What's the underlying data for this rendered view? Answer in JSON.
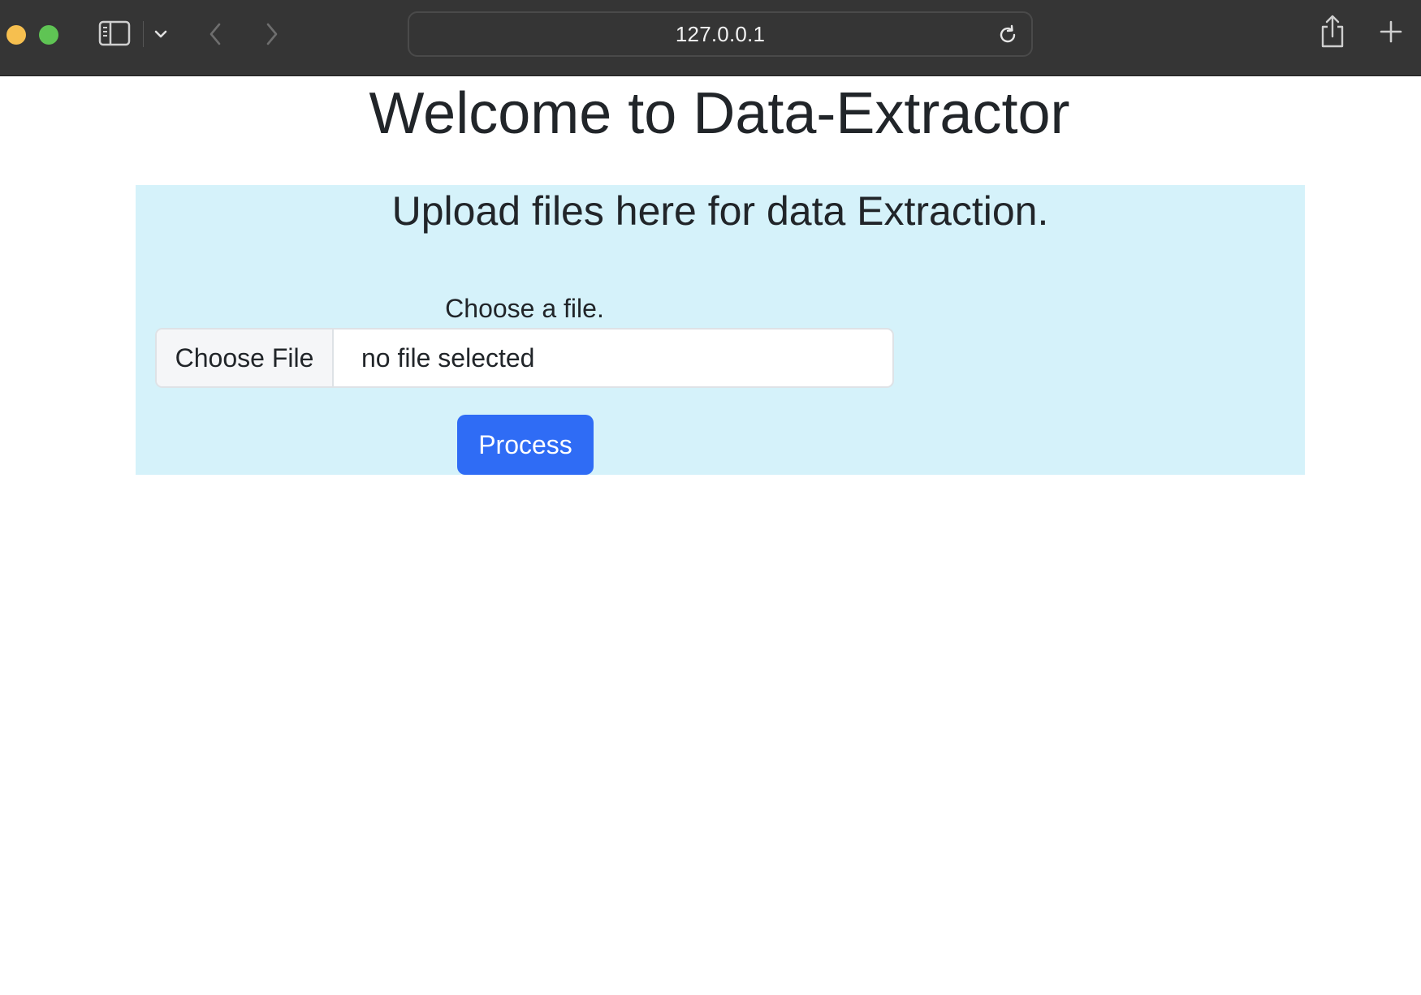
{
  "browser": {
    "url": "127.0.0.1",
    "icons": {
      "sidebar": "sidebar-icon",
      "tab_menu": "chevron-down-icon",
      "back": "chevron-left-icon",
      "forward": "chevron-right-icon",
      "reload": "reload-icon",
      "share": "share-icon",
      "new_tab": "plus-icon"
    }
  },
  "page": {
    "title": "Welcome to Data-Extractor"
  },
  "upload": {
    "heading": "Upload files here for data Extraction.",
    "file_label": "Choose a file.",
    "choose_button": "Choose File",
    "file_status": "no file selected",
    "process_button": "Process"
  },
  "colors": {
    "panel_background": "#d5f2fa",
    "primary_button": "#2f6cf5",
    "toolbar": "#353535"
  }
}
